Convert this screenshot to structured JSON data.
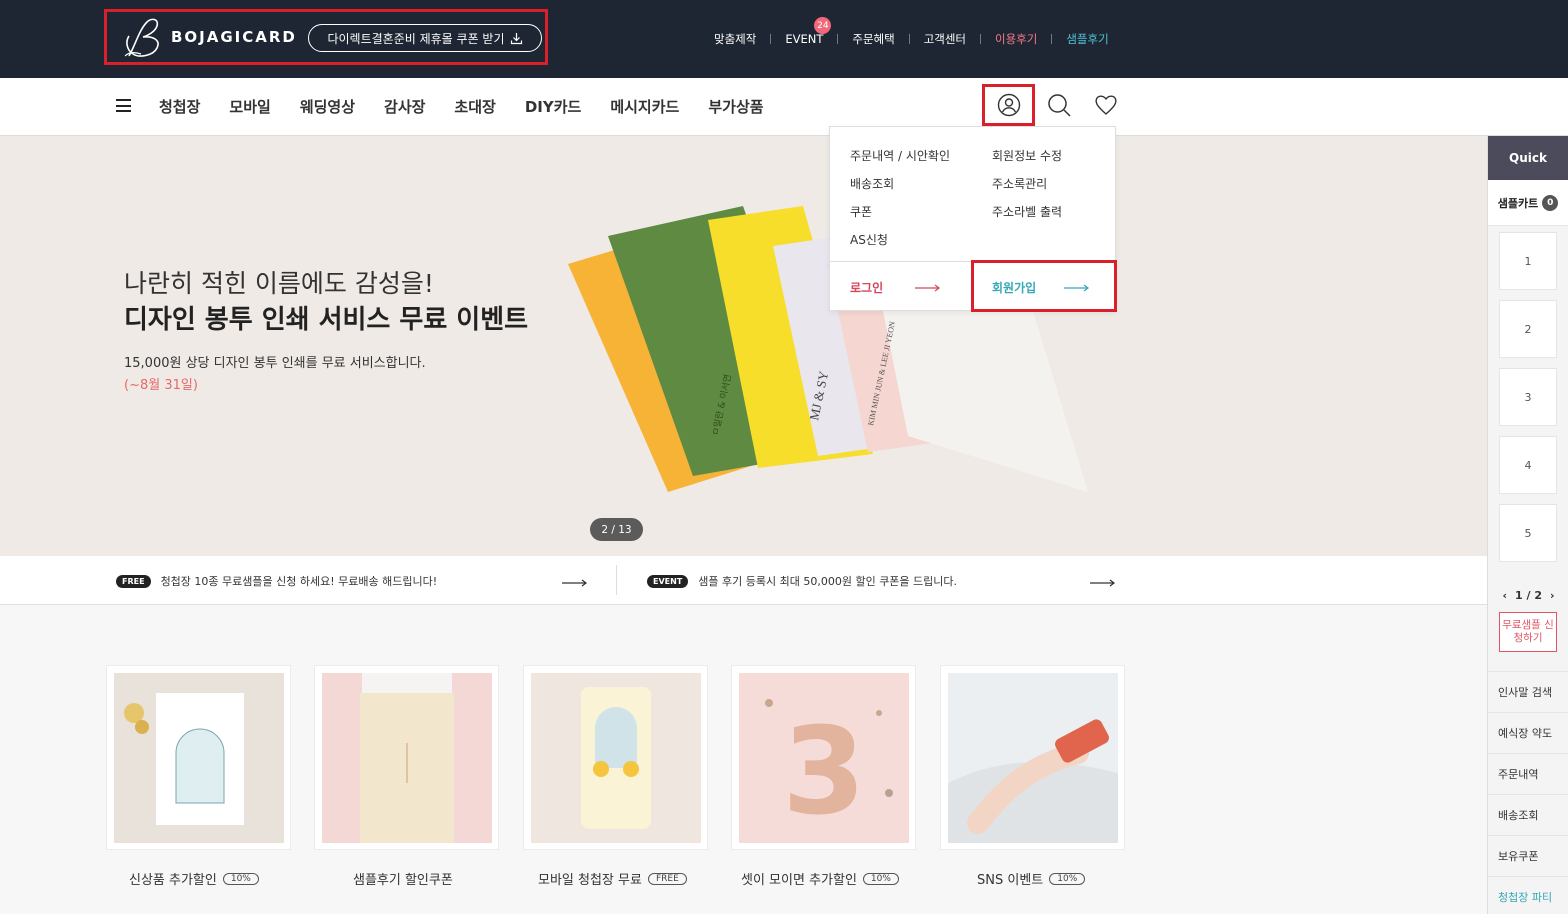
{
  "header": {
    "logo_text": "BOJAGICARD",
    "coupon_button": "다이렉트결혼준비 제휴몰 쿠폰 받기",
    "util_links": [
      {
        "label": "맞춤제작"
      },
      {
        "label": "EVENT",
        "badge": "24"
      },
      {
        "label": "주문혜택"
      },
      {
        "label": "고객센터"
      },
      {
        "label": "이용후기",
        "color": "#f07a8a"
      },
      {
        "label": "샘플후기",
        "color": "#4fc1d3"
      }
    ]
  },
  "nav": {
    "items": [
      "청첩장",
      "모바일",
      "웨딩영상",
      "감사장",
      "초대장",
      "DIY카드",
      "메시지카드",
      "부가상품"
    ]
  },
  "user_menu": {
    "left": [
      "주문내역 / 시안확인",
      "배송조회",
      "쿠폰",
      "AS신청"
    ],
    "right": [
      "회원정보 수정",
      "주소록관리",
      "주소라벨 출력"
    ],
    "login": "로그인",
    "signup": "회원가입"
  },
  "hero": {
    "line1": "나란히 적힌 이름에도 감성을!",
    "line2": "디자인 봉투 인쇄 서비스 무료 이벤트",
    "desc": "15,000원 상당 디자인 봉투 인쇄를 무료 서비스합니다.",
    "period": "(~8월 31일)",
    "pager": "2 / 13",
    "envelope_texts": [
      "MJ & SY",
      "KIM MIN JUN & LEE JI YEON",
      "ㅁ일란 & 이서연"
    ]
  },
  "notices": [
    {
      "tag": "FREE",
      "text": "청첩장 10종 무료샘플을 신청 하세요! 무료배송 해드립니다!"
    },
    {
      "tag": "EVENT",
      "text": "샘플 후기 등록시 최대 50,000원 할인 쿠폰을 드립니다."
    }
  ],
  "cards": [
    {
      "label": "신상품 추가할인",
      "badge": "10%"
    },
    {
      "label": "샘플후기 할인쿠폰",
      "badge": ""
    },
    {
      "label": "모바일 청첩장 무료",
      "badge": "FREE"
    },
    {
      "label": "셋이 모이면 추가할인",
      "badge": "10%"
    },
    {
      "label": "SNS 이벤트",
      "badge": "10%"
    }
  ],
  "quick": {
    "title": "Quick",
    "cart_label": "샘플카트",
    "cart_count": "0",
    "slots": [
      "1",
      "2",
      "3",
      "4",
      "5"
    ],
    "page": "1 / 2",
    "free_sample": "무료샘플 신청하기",
    "links": [
      "인사말 검색",
      "예식장 약도",
      "주문내역",
      "배송조회",
      "보유쿠폰",
      "청첩장 파티"
    ]
  },
  "colors": {
    "topbar": "#1f2633",
    "highlight": "#d9202b",
    "login": "#d5465c",
    "signup": "#35a7b6"
  }
}
